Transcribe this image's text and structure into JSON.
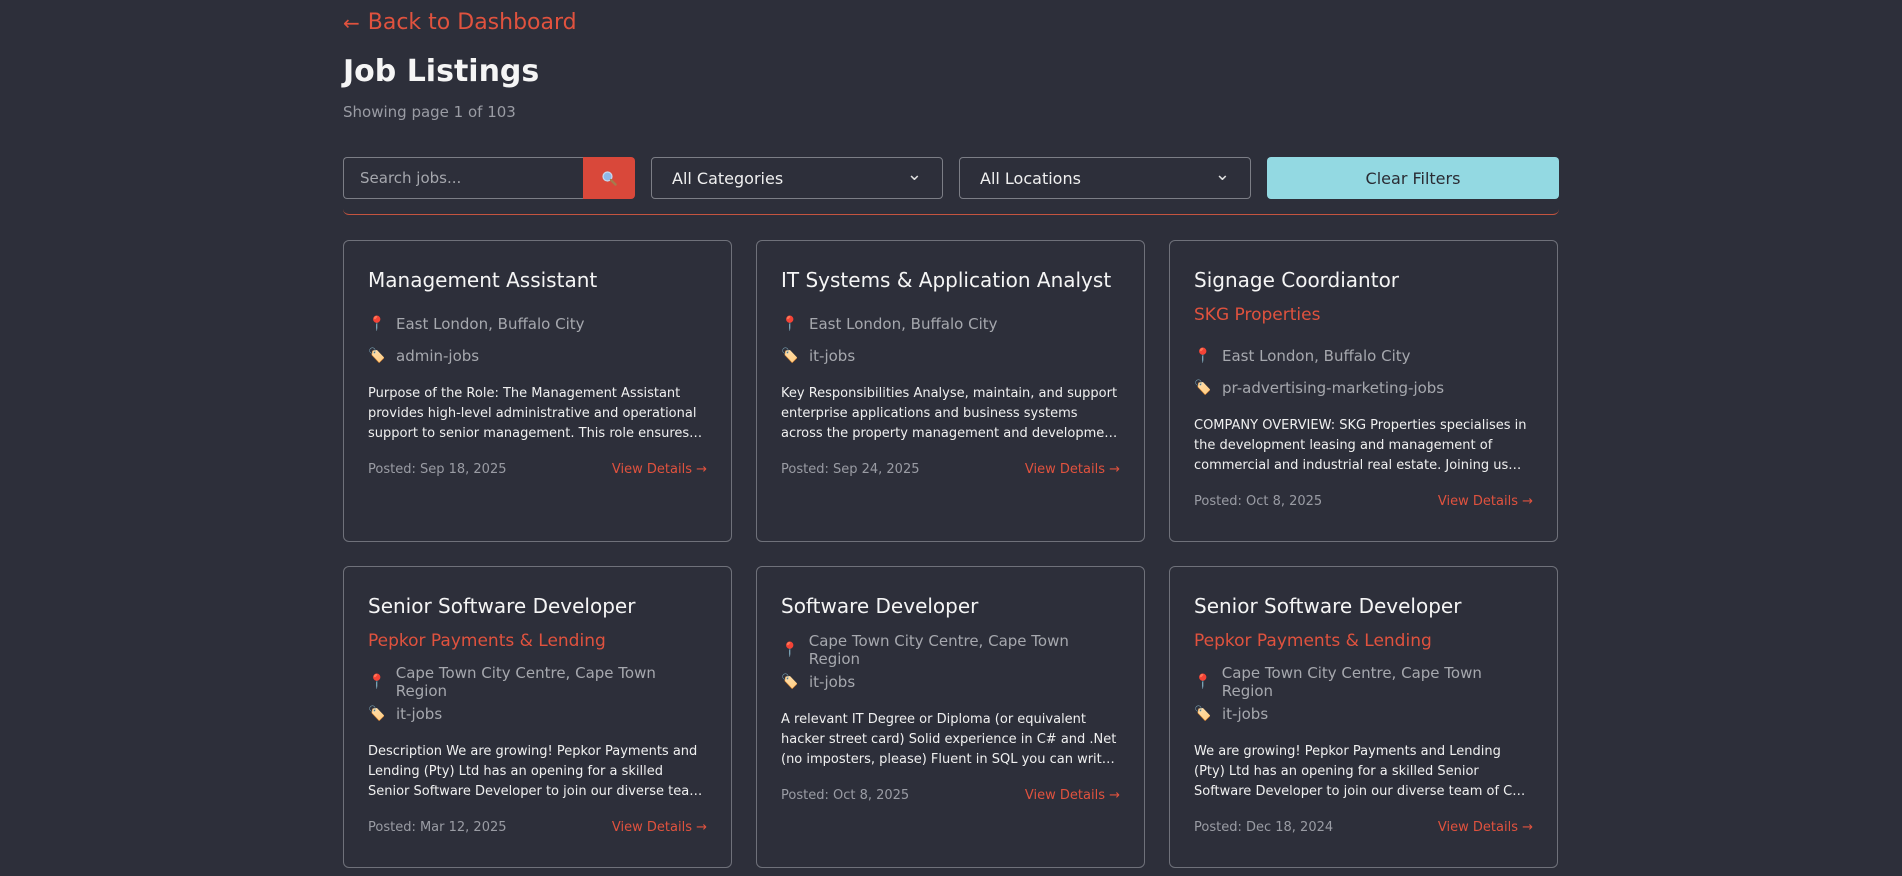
{
  "nav": {
    "back_label": "Back to Dashboard",
    "back_arrow": "←"
  },
  "header": {
    "title": "Job Listings",
    "page_info": "Showing page 1 of 103"
  },
  "filters": {
    "search_placeholder": "Search jobs...",
    "search_icon": "search-icon",
    "category_selected": "All Categories",
    "location_selected": "All Locations",
    "clear_label": "Clear Filters"
  },
  "accent_color": "#e0523e",
  "clear_button_color": "#93d9e2",
  "jobs": [
    {
      "title": "Management Assistant",
      "company": "",
      "location": "East London, Buffalo City",
      "category": "admin-jobs",
      "description": "Purpose of the Role: The Management Assistant provides high-level administrative and operational support to senior management. This role ensures the smooth running of daily operations.",
      "posted": "Posted: Sep 18, 2025",
      "link": "View Details →"
    },
    {
      "title": "IT Systems & Application Analyst",
      "company": "",
      "location": "East London, Buffalo City",
      "category": "it-jobs",
      "description": "Key Responsibilities Analyse, maintain, and support enterprise applications and business systems across the property management and development portfolio.",
      "posted": "Posted: Sep 24, 2025",
      "link": "View Details →"
    },
    {
      "title": "Signage Coordiantor",
      "company": "SKG Properties",
      "location": "East London, Buffalo City",
      "category": "pr-advertising-marketing-jobs",
      "description": "COMPANY OVERVIEW: SKG Properties specialises in the development leasing and management of commercial and industrial real estate. Joining us means joining a growing team.",
      "posted": "Posted: Oct 8, 2025",
      "link": "View Details →"
    },
    {
      "title": "Senior Software Developer",
      "company": "Pepkor Payments & Lending",
      "location": "Cape Town City Centre, Cape Town Region",
      "category": "it-jobs",
      "description": "Description We are growing! Pepkor Payments and Lending (Pty) Ltd has an opening for a skilled Senior Software Developer to join our diverse team of C# developers.",
      "posted": "Posted: Mar 12, 2025",
      "link": "View Details →"
    },
    {
      "title": "Software Developer",
      "company": "",
      "location": "Cape Town City Centre, Cape Town Region",
      "category": "it-jobs",
      "description": "A relevant IT Degree or Diploma (or equivalent hacker street card) Solid experience in C# and .Net (no imposters, please) Fluent in SQL you can write queries in your sleep.",
      "posted": "Posted: Oct 8, 2025",
      "link": "View Details →"
    },
    {
      "title": "Senior Software Developer",
      "company": "Pepkor Payments & Lending",
      "location": "Cape Town City Centre, Cape Town Region",
      "category": "it-jobs",
      "description": "We are growing! Pepkor Payments and Lending (Pty) Ltd has an opening for a skilled Senior Software Developer to join our diverse team of C# developers.",
      "posted": "Posted: Dec 18, 2024",
      "link": "View Details →"
    }
  ]
}
